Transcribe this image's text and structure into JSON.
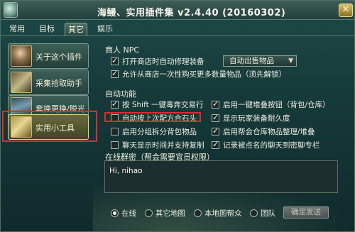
{
  "window": {
    "title": "海鳗、实用插件集 v2.4.40 (20160302)",
    "close_label": "✕"
  },
  "tabs": [
    {
      "label": "常用",
      "active": false
    },
    {
      "label": "目标",
      "active": false
    },
    {
      "label": "其它",
      "active": true
    },
    {
      "label": "娱乐",
      "active": false
    }
  ],
  "sidebar": {
    "items": [
      {
        "label": "关于这个插件",
        "selected": false
      },
      {
        "label": "采集拾取助手",
        "selected": false
      },
      {
        "label": "套换更换/脱光",
        "selected": false
      },
      {
        "label": "实用小工具",
        "selected": true
      }
    ]
  },
  "npc": {
    "title": "商人 NPC",
    "auto_repair_label": "打开商店时自动修理装备",
    "auto_repair_checked": true,
    "sell_dropdown_value": "自动出售物品",
    "bulk_buy_label": "允许从商店一次性购买更多数量物品（须先解锁）",
    "bulk_buy_checked": true
  },
  "auto": {
    "title": "自动功能",
    "items": [
      {
        "label": "按 Shift 一键毒奔交易行",
        "checked": true
      },
      {
        "label": "启用一键堆叠按钮（背包/仓库）",
        "checked": true
      },
      {
        "label": "自动按上次配方合石头",
        "checked": false
      },
      {
        "label": "显示玩家装备耐久度",
        "checked": true
      },
      {
        "label": "启用分组拆分背包物品",
        "checked": false
      },
      {
        "label": "启用帮会仓库物品整理/堆叠",
        "checked": true
      },
      {
        "label": "聊天显示时间并支持复制",
        "checked": false
      },
      {
        "label": "记录被点名的聊天到密聊专栏",
        "checked": true
      }
    ]
  },
  "group": {
    "title": "在线群密（帮会需要官员权限）",
    "message": "Hi, nihao"
  },
  "radios": [
    {
      "label": "在线",
      "selected": true
    },
    {
      "label": "其它地图",
      "selected": false
    },
    {
      "label": "本地图帮众",
      "selected": false
    },
    {
      "label": "团队",
      "selected": false
    }
  ],
  "confirm_label": "确定发送"
}
